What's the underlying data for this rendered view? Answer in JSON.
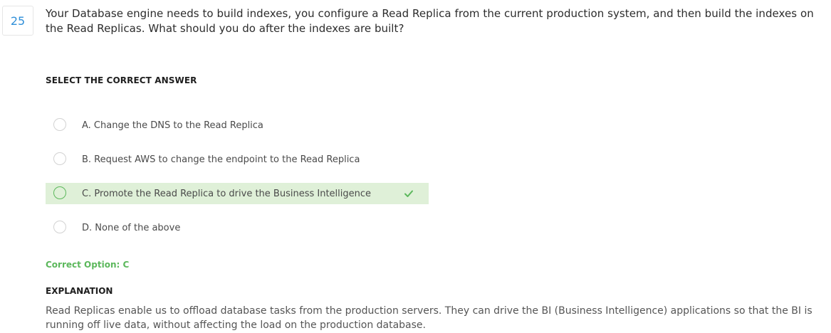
{
  "question": {
    "number": "25",
    "text": "Your Database engine needs to build indexes, you configure a Read Replica from the current production system, and then build the indexes on the Read Replicas. What should you do after the indexes are built?"
  },
  "answer_section": {
    "header": "SELECT THE CORRECT ANSWER",
    "options": [
      {
        "label": "A. Change the DNS to the Read Replica",
        "correct": false
      },
      {
        "label": "B. Request AWS to change the endpoint to the Read Replica",
        "correct": false
      },
      {
        "label": "C. Promote the Read Replica to drive the Business Intelligence",
        "correct": true
      },
      {
        "label": "D. None of the above",
        "correct": false
      }
    ],
    "correct_option_text": "Correct Option: C"
  },
  "explanation": {
    "header": "EXPLANATION",
    "text": "Read Replicas enable us to offload database tasks from the production servers. They can drive the BI (Business Intelligence) applications so that the BI is running off live data, without affecting the load on the production database."
  },
  "colors": {
    "accent_blue": "#2f8fd8",
    "correct_green": "#5cb85c",
    "correct_bg": "#dff0d8"
  },
  "icons": {
    "correct_mark": "check-icon"
  }
}
